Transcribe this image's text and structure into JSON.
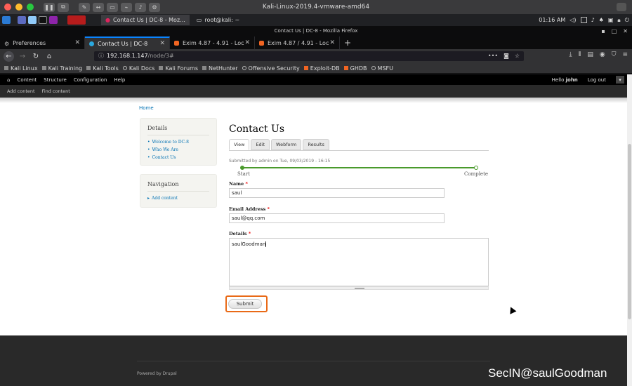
{
  "vm": {
    "title": "Kali-Linux-2019.4-vmware-amd64",
    "colors": {
      "close": "#ff5f57",
      "min": "#febc2e",
      "max": "#28c840"
    }
  },
  "panel": {
    "tasks": [
      {
        "label": "Contact Us | DC-8 - Moz...",
        "active": true
      },
      {
        "label": "root@kali: ~",
        "active": false
      }
    ],
    "clock": "01:16 AM"
  },
  "firefox": {
    "window_title": "Contact Us | DC-8 - Mozilla Firefox",
    "tabs": [
      {
        "label": "Preferences",
        "icon": "gear-icon",
        "active": false
      },
      {
        "label": "Contact Us | DC-8",
        "icon": "drupal-icon",
        "active": true
      },
      {
        "label": "Exim 4.87 - 4.91 - Local I",
        "icon": "exploit-db-icon",
        "active": false
      },
      {
        "label": "Exim 4.87 / 4.91 - Local I",
        "icon": "exploit-db-icon",
        "active": false
      }
    ],
    "url_host": "192.168.1.147",
    "url_path": "/node/3#",
    "bookmarks": [
      "Kali Linux",
      "Kali Training",
      "Kali Tools",
      "Kali Docs",
      "Kali Forums",
      "NetHunter",
      "Offensive Security",
      "Exploit-DB",
      "GHDB",
      "MSFU"
    ]
  },
  "drupal": {
    "toolbar": [
      "Content",
      "Structure",
      "Configuration",
      "Help"
    ],
    "hello_prefix": "Hello ",
    "user": "john",
    "logout": "Log out",
    "shortcuts": [
      "Add content",
      "Find content"
    ]
  },
  "page": {
    "breadcrumb": "Home",
    "details_block": {
      "title": "Details",
      "links": [
        "Welcome to DC-8",
        "Who We Are",
        "Contact Us"
      ]
    },
    "navigation_block": {
      "title": "Navigation",
      "links": [
        "Add content"
      ]
    },
    "title": "Contact Us",
    "local_tabs": [
      "View",
      "Edit",
      "Webform",
      "Results"
    ],
    "submitted": "Submitted by admin on Tue, 09/03/2019 - 16:15",
    "progress": {
      "start": "Start",
      "end": "Complete"
    },
    "form": {
      "name_label": "Name",
      "name_value": "saul",
      "email_label": "Email Address",
      "email_value": "saul@qq.com",
      "details_label": "Details",
      "details_value": "saulGoodman",
      "required_mark": "*",
      "submit": "Submit"
    },
    "footer": "Powered by Drupal",
    "watermark": "SecIN@saulGoodman"
  }
}
